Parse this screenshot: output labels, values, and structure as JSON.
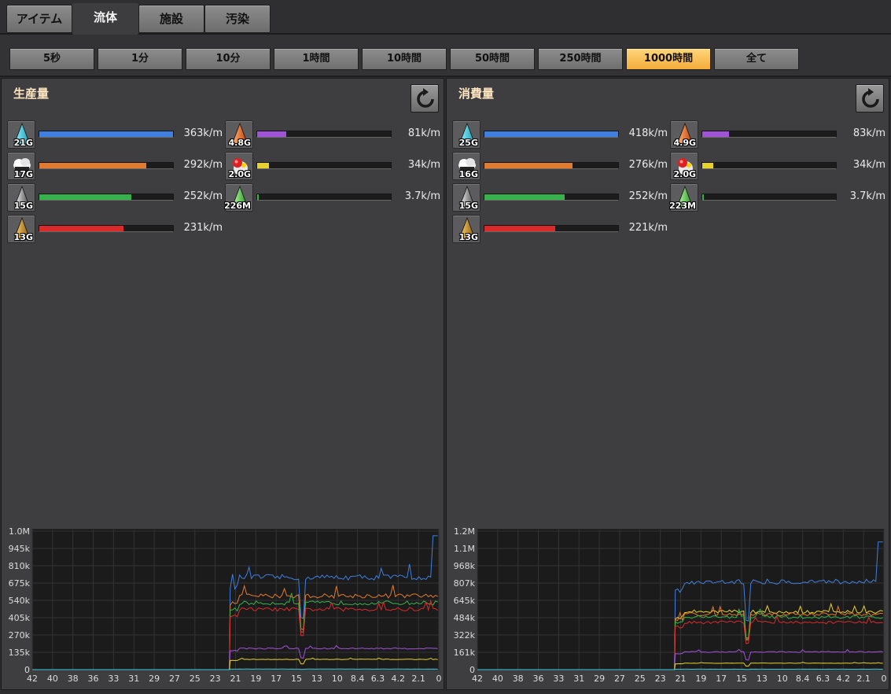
{
  "tabs": [
    {
      "label": "アイテム",
      "active": false
    },
    {
      "label": "流体",
      "active": true
    },
    {
      "label": "施設",
      "active": false
    },
    {
      "label": "汚染",
      "active": false
    }
  ],
  "time_ranges": [
    {
      "label": "5秒",
      "selected": false
    },
    {
      "label": "1分",
      "selected": false
    },
    {
      "label": "10分",
      "selected": false
    },
    {
      "label": "1時間",
      "selected": false
    },
    {
      "label": "10時間",
      "selected": false
    },
    {
      "label": "50時間",
      "selected": false
    },
    {
      "label": "250時間",
      "selected": false
    },
    {
      "label": "1000時間",
      "selected": true
    },
    {
      "label": "全て",
      "selected": false
    }
  ],
  "colors": {
    "blue": "#3f7fe0",
    "orange": "#e07a2e",
    "green": "#36b24a",
    "red": "#dc2a2a",
    "purple": "#a052d8",
    "yellow": "#e8d12a",
    "cyan": "#38c8d8"
  },
  "production": {
    "title": "生産量",
    "items": [
      {
        "icon": "water-drop-icon",
        "count": "21G",
        "rate": "363k/m",
        "fill": 1.0,
        "color": "#3f7fe0"
      },
      {
        "icon": "steam-cloud-icon",
        "count": "17G",
        "rate": "292k/m",
        "fill": 0.8,
        "color": "#e07a2e"
      },
      {
        "icon": "lubricant-drop-icon",
        "count": "15G",
        "rate": "252k/m",
        "fill": 0.69,
        "color": "#36b24a"
      },
      {
        "icon": "crude-oil-drop-icon",
        "count": "13G",
        "rate": "231k/m",
        "fill": 0.63,
        "color": "#dc2a2a"
      },
      {
        "icon": "heavy-oil-drop-icon",
        "count": "4.8G",
        "rate": "81k/m",
        "fill": 0.22,
        "color": "#a052d8"
      },
      {
        "icon": "petroleum-gas-bubble-icon",
        "count": "2.0G",
        "rate": "34k/m",
        "fill": 0.09,
        "color": "#e8d12a"
      },
      {
        "icon": "light-oil-drop-icon",
        "count": "226M",
        "rate": "3.7k/m",
        "fill": 0.01,
        "color": "#36b24a"
      }
    ],
    "chart": {
      "y_ticks": [
        "1.0M",
        "945k",
        "810k",
        "675k",
        "540k",
        "405k",
        "270k",
        "135k",
        "0"
      ],
      "x_ticks": [
        "42",
        "40",
        "38",
        "36",
        "33",
        "31",
        "29",
        "27",
        "25",
        "23",
        "21",
        "19",
        "17",
        "15",
        "13",
        "10",
        "8.4",
        "6.3",
        "4.2",
        "2.1",
        "0"
      ],
      "y_max": 1080000,
      "series": [
        {
          "color": "#3f7fe0",
          "level": 720000
        },
        {
          "color": "#e07a2e",
          "level": 575000
        },
        {
          "color": "#36b24a",
          "level": 520000
        },
        {
          "color": "#dc2a2a",
          "level": 470000
        },
        {
          "color": "#a052d8",
          "level": 165000
        },
        {
          "color": "#e8d12a",
          "level": 80000
        },
        {
          "color": "#38c8d8",
          "level": 4000
        }
      ]
    }
  },
  "consumption": {
    "title": "消費量",
    "items": [
      {
        "icon": "water-drop-icon",
        "count": "25G",
        "rate": "418k/m",
        "fill": 1.0,
        "color": "#3f7fe0"
      },
      {
        "icon": "steam-cloud-icon",
        "count": "16G",
        "rate": "276k/m",
        "fill": 0.66,
        "color": "#e07a2e"
      },
      {
        "icon": "lubricant-drop-icon",
        "count": "15G",
        "rate": "252k/m",
        "fill": 0.6,
        "color": "#36b24a"
      },
      {
        "icon": "crude-oil-drop-icon",
        "count": "13G",
        "rate": "221k/m",
        "fill": 0.53,
        "color": "#dc2a2a"
      },
      {
        "icon": "heavy-oil-drop-icon",
        "count": "4.9G",
        "rate": "83k/m",
        "fill": 0.2,
        "color": "#a052d8"
      },
      {
        "icon": "petroleum-gas-bubble-icon",
        "count": "2.0G",
        "rate": "34k/m",
        "fill": 0.08,
        "color": "#e8d12a"
      },
      {
        "icon": "light-oil-drop-icon",
        "count": "223M",
        "rate": "3.7k/m",
        "fill": 0.01,
        "color": "#36b24a"
      }
    ],
    "chart": {
      "y_ticks": [
        "1.2M",
        "1.1M",
        "968k",
        "807k",
        "645k",
        "484k",
        "322k",
        "161k",
        "0"
      ],
      "x_ticks": [
        "42",
        "40",
        "38",
        "36",
        "33",
        "31",
        "29",
        "27",
        "25",
        "23",
        "21",
        "19",
        "17",
        "15",
        "13",
        "10",
        "8.4",
        "6.3",
        "4.2",
        "2.1",
        "0"
      ],
      "y_max": 1290000,
      "series": [
        {
          "color": "#3f7fe0",
          "level": 820000
        },
        {
          "color": "#e8d12a",
          "level": 540000
        },
        {
          "color": "#e07a2e",
          "level": 515000
        },
        {
          "color": "#36b24a",
          "level": 490000
        },
        {
          "color": "#dc2a2a",
          "level": 440000
        },
        {
          "color": "#a052d8",
          "level": 165000
        },
        {
          "color": "#e8d12a",
          "level": 60000
        },
        {
          "color": "#38c8d8",
          "level": 4000
        }
      ]
    }
  }
}
